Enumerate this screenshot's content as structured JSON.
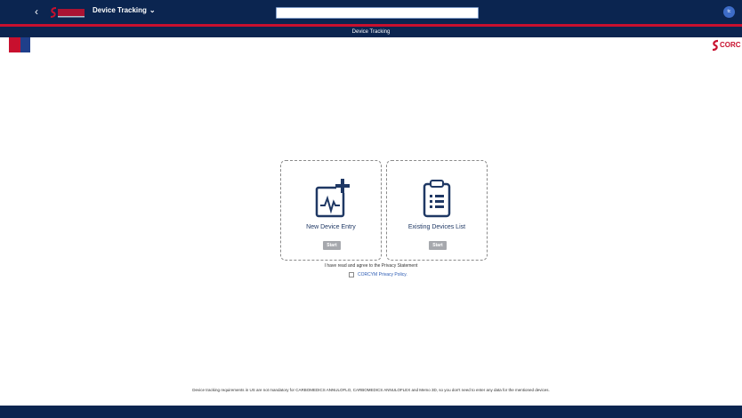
{
  "shell": {
    "back_glyph": "‹",
    "logo_text": "CORCYM",
    "app_title": "Device Tracking",
    "title_chevron": "⌄",
    "search_value": "",
    "avatar_initials": "tc"
  },
  "subheader": {
    "title": "Device Tracking"
  },
  "brand": {
    "corner_logo_text": "CORC",
    "navy": "#0b2550",
    "red": "#c8102e",
    "blue": "#1f3f8a"
  },
  "tiles": [
    {
      "label": "New Device Entry",
      "button": "Start",
      "icon": "ecg-monitor-plus-icon"
    },
    {
      "label": "Existing Devices List",
      "button": "Start",
      "icon": "clipboard-list-icon"
    }
  ],
  "agreement": {
    "statement": "I have read and agree to the Privacy Statement",
    "link": "CORCYM Privacy Policy."
  },
  "disclaimer": "Device tracking requirements in US are not mandatory for CARBOMEDICS ANNULOFLO, CARBOMEDICS ANNULOFLEX and Memo 3D, so you don't need to enter any data for the mentioned devices."
}
